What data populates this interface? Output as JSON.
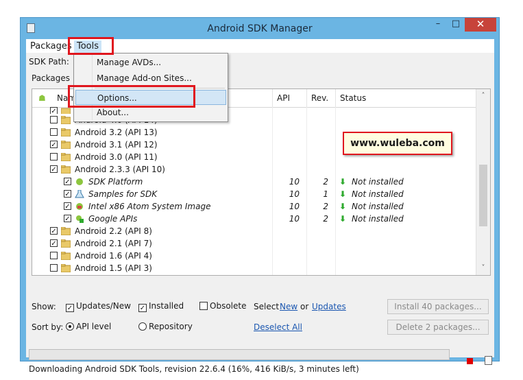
{
  "window": {
    "title": "Android SDK Manager",
    "minimize": "–",
    "maximize": "□",
    "close": "✕"
  },
  "menu": {
    "packages": "Packages",
    "tools": "Tools"
  },
  "tools_menu": {
    "items": [
      "Manage AVDs...",
      "Manage Add-on Sites...",
      "Options...",
      "About..."
    ],
    "highlighted": "Options..."
  },
  "sdk_path_label": "SDK Path:",
  "packages_label": "Packages",
  "table": {
    "columns": {
      "name": "Nam",
      "api": "API",
      "rev": "Rev.",
      "status": "Status"
    },
    "rows": [
      {
        "name": "Android 4.0 (API 14)",
        "checked": false,
        "level": 0,
        "api": "",
        "rev": "",
        "status": ""
      },
      {
        "name": "Android 3.2 (API 13)",
        "checked": false,
        "level": 0,
        "api": "",
        "rev": "",
        "status": ""
      },
      {
        "name": "Android 3.1 (API 12)",
        "checked": true,
        "level": 0,
        "api": "",
        "rev": "",
        "status": ""
      },
      {
        "name": "Android 3.0 (API 11)",
        "checked": false,
        "level": 0,
        "api": "",
        "rev": "",
        "status": ""
      },
      {
        "name": "Android 2.3.3 (API 10)",
        "checked": true,
        "level": 0,
        "api": "",
        "rev": "",
        "status": ""
      },
      {
        "name": "SDK Platform",
        "checked": true,
        "level": 1,
        "api": "10",
        "rev": "2",
        "status": "Not installed"
      },
      {
        "name": "Samples for SDK",
        "checked": true,
        "level": 1,
        "api": "10",
        "rev": "1",
        "status": "Not installed"
      },
      {
        "name": "Intel x86 Atom System Image",
        "checked": true,
        "level": 1,
        "api": "10",
        "rev": "2",
        "status": "Not installed"
      },
      {
        "name": "Google APIs",
        "checked": true,
        "level": 1,
        "api": "10",
        "rev": "2",
        "status": "Not installed"
      },
      {
        "name": "Android 2.2 (API 8)",
        "checked": true,
        "level": 0,
        "api": "",
        "rev": "",
        "status": ""
      },
      {
        "name": "Android 2.1 (API 7)",
        "checked": true,
        "level": 0,
        "api": "",
        "rev": "",
        "status": ""
      },
      {
        "name": "Android 1.6 (API 4)",
        "checked": false,
        "level": 0,
        "api": "",
        "rev": "",
        "status": ""
      },
      {
        "name": "Android 1.5 (API 3)",
        "checked": false,
        "level": 0,
        "api": "",
        "rev": "",
        "status": ""
      }
    ]
  },
  "show": {
    "label": "Show:",
    "updates_new": "Updates/New",
    "installed": "Installed",
    "obsolete": "Obsolete",
    "select": "Select",
    "new_link": "New",
    "or": "or",
    "updates_link": "Updates"
  },
  "sort": {
    "label": "Sort by:",
    "api_level": "API level",
    "repository": "Repository",
    "deselect_all": "Deselect All"
  },
  "buttons": {
    "install": "Install 40 packages...",
    "delete": "Delete 2 packages..."
  },
  "status_bar": {
    "text": "Downloading Android SDK Tools, revision 22.6.4 (16%, 416 KiB/s, 3 minutes left)",
    "progress_fraction": 0.0
  },
  "watermark": "www.wuleba.com",
  "colors": {
    "title_bg": "#6bb5e3",
    "close_btn": "#c7433a",
    "highlight_box": "#e0161e",
    "green_arrow": "#2eaa2e"
  }
}
